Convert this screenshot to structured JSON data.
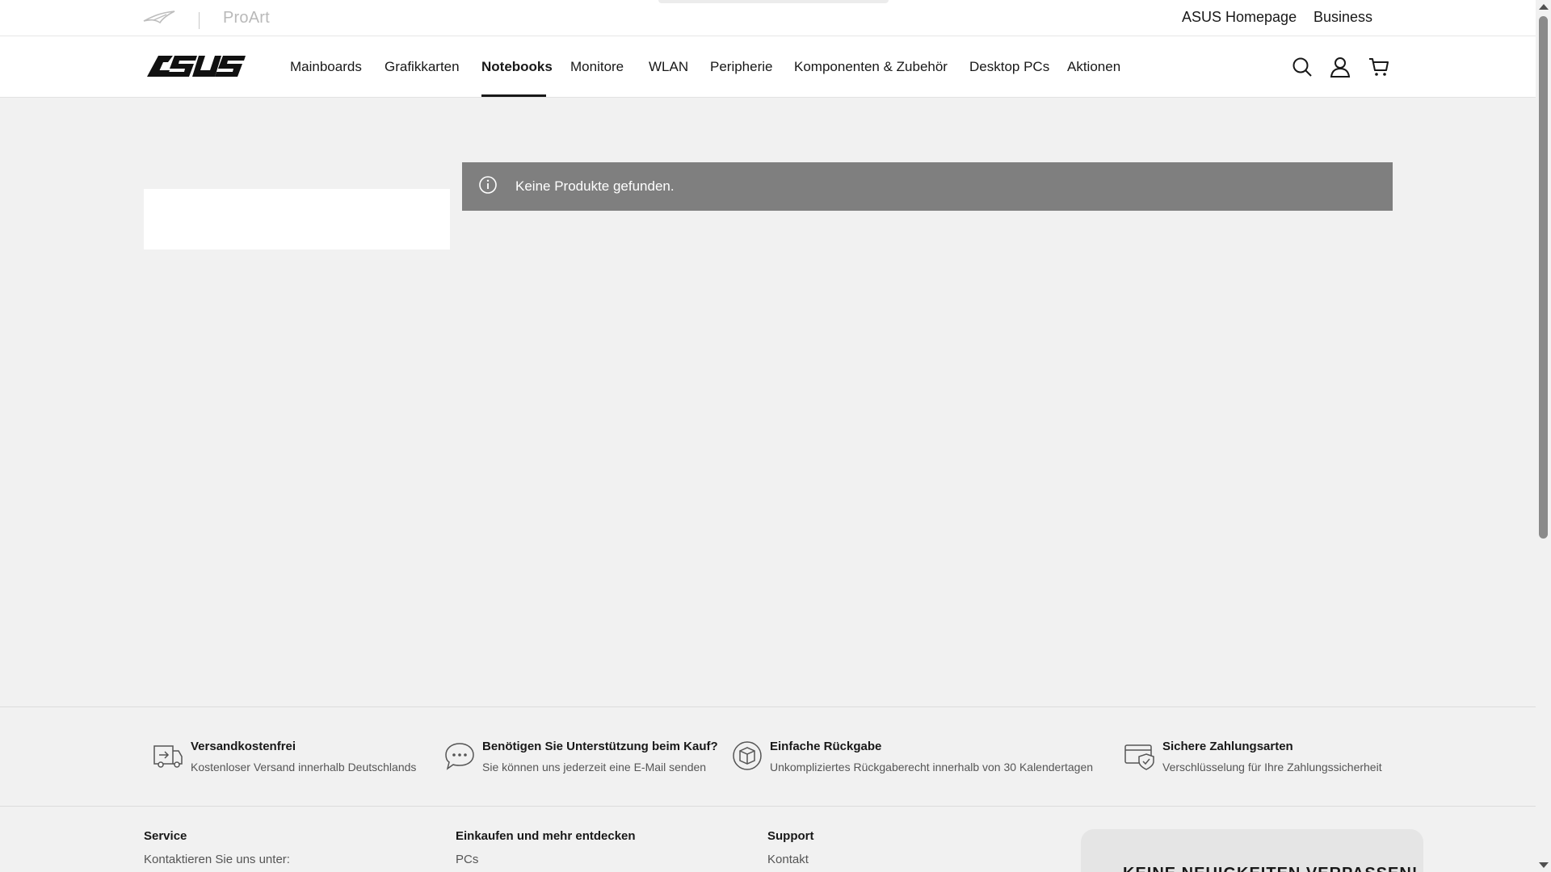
{
  "topbar": {
    "proart": "ProArt",
    "links": {
      "home": "ASUS Homepage",
      "business": "Business"
    }
  },
  "nav": {
    "items": [
      "Mainboards",
      "Grafikkarten",
      "Notebooks",
      "Monitore",
      "WLAN",
      "Peripherie",
      "Komponenten & Zubehör",
      "Desktop PCs",
      "Aktionen"
    ],
    "active": "Notebooks",
    "icons": [
      "search-icon",
      "user-icon",
      "cart-icon"
    ]
  },
  "notice": {
    "text": "Keine Produkte gefunden.",
    "icon": "info-icon"
  },
  "features": [
    {
      "title": "Versandkostenfrei",
      "subtitle": "Kostenloser Versand innerhalb Deutschlands",
      "icon": "shipping-icon"
    },
    {
      "title": "Benötigen Sie Unterstützung beim Kauf?",
      "subtitle": "Sie können uns jederzeit eine E-Mail senden",
      "icon": "chat-icon"
    },
    {
      "title": "Einfache Rückgabe",
      "subtitle": "Unkompliziertes Rückgaberecht innerhalb von 30 Kalendertagen",
      "icon": "return-box-icon"
    },
    {
      "title": "Sichere Zahlungsarten",
      "subtitle": "Verschlüsselung für Ihre Zahlungssicherheit",
      "icon": "secure-payment-icon"
    }
  ],
  "footer": {
    "service": {
      "heading": "Service",
      "line": "Kontaktieren Sie uns unter:"
    },
    "shop": {
      "heading": "Einkaufen und mehr entdecken",
      "link": "PCs"
    },
    "support": {
      "heading": "Support",
      "link": "Kontakt"
    },
    "newsletter": "KEINE NEUIGKEITEN VERPASSEN!"
  },
  "colors": {
    "accent": "#181818",
    "notice_bg": "#7f7f7f",
    "page_bg": "#f1f1f1"
  }
}
